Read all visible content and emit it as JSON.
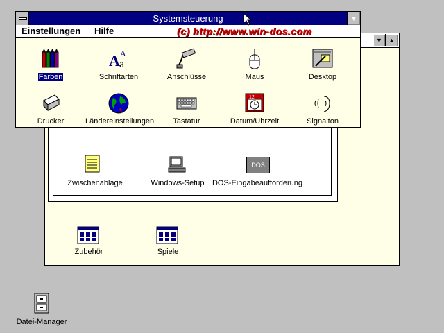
{
  "control_panel": {
    "title": "Systemsteuerung",
    "menu": [
      "Einstellungen",
      "Hilfe"
    ],
    "watermark": "(c) http://www.win-dos.com",
    "items": [
      {
        "label": "Farben",
        "icon": "color-pencils-icon",
        "selected": true
      },
      {
        "label": "Schriftarten",
        "icon": "fonts-icon"
      },
      {
        "label": "Anschlüsse",
        "icon": "ports-icon"
      },
      {
        "label": "Maus",
        "icon": "mouse-icon"
      },
      {
        "label": "Desktop",
        "icon": "desktop-icon"
      },
      {
        "label": "Drucker",
        "icon": "printer-icon"
      },
      {
        "label": "Ländereinstellungen",
        "icon": "globe-icon"
      },
      {
        "label": "Tastatur",
        "icon": "keyboard-icon"
      },
      {
        "label": "Datum/Uhrzeit",
        "icon": "calendar-clock-icon"
      },
      {
        "label": "Signalton",
        "icon": "sound-icon"
      }
    ]
  },
  "program_manager": {
    "group_items": [
      {
        "label": "Zwischenablage",
        "icon": "clipboard-icon"
      },
      {
        "label": "Windows-Setup",
        "icon": "setup-icon"
      },
      {
        "label": "DOS-Eingabeaufforderung",
        "icon": "dos-icon",
        "icon_text": "DOS"
      }
    ],
    "groups": [
      {
        "label": "Zubehör",
        "icon": "program-group-icon"
      },
      {
        "label": "Spiele",
        "icon": "program-group-icon"
      }
    ]
  },
  "desktop_icons": [
    {
      "label": "Datei-Manager",
      "icon": "file-cabinet-icon"
    }
  ]
}
